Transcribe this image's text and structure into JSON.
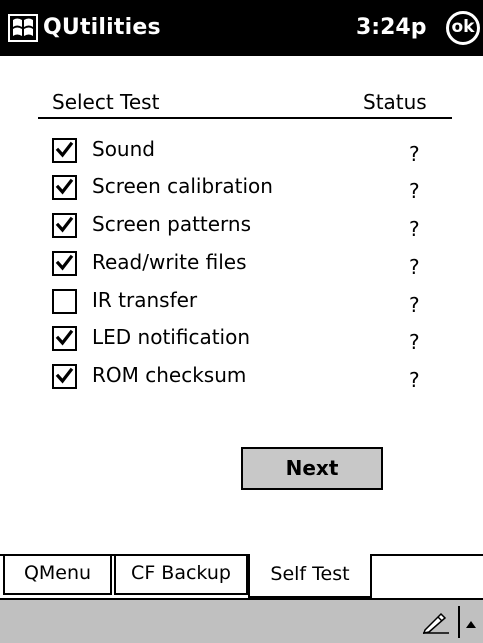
{
  "titlebar": {
    "app_title": "QUtilities",
    "clock": "3:24p",
    "ok_label": "ok"
  },
  "table": {
    "header_select": "Select Test",
    "header_status": "Status"
  },
  "tests": [
    {
      "label": "Sound",
      "checked": true,
      "status": "?"
    },
    {
      "label": "Screen calibration",
      "checked": true,
      "status": "?"
    },
    {
      "label": "Screen patterns",
      "checked": true,
      "status": "?"
    },
    {
      "label": "Read/write files",
      "checked": true,
      "status": "?"
    },
    {
      "label": "IR transfer",
      "checked": false,
      "status": "?"
    },
    {
      "label": "LED notification",
      "checked": true,
      "status": "?"
    },
    {
      "label": "ROM checksum",
      "checked": true,
      "status": "?"
    }
  ],
  "next_label": "Next",
  "tabs": [
    {
      "label": "QMenu",
      "active": false
    },
    {
      "label": "CF Backup",
      "active": false
    },
    {
      "label": "Self Test",
      "active": true
    }
  ],
  "colors": {
    "titlebar_bg": "#000000",
    "button_bg": "#c8c8c8",
    "bottom_bar_bg": "#c0c0c0"
  },
  "icons": {
    "start": "start-flag-icon",
    "ok": "ok-icon",
    "input": "pen-icon",
    "sip": "up-arrow-icon"
  }
}
